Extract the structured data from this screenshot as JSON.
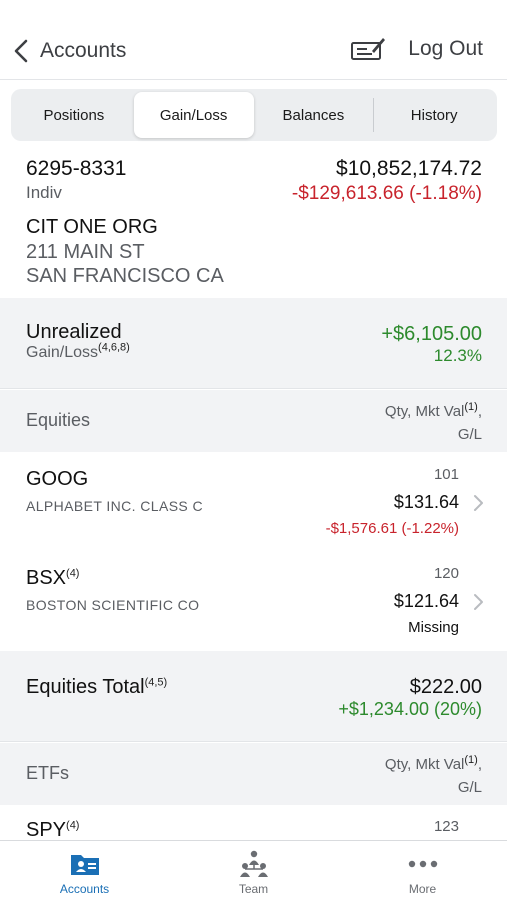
{
  "nav": {
    "back_label": "Accounts",
    "logout_label": "Log Out"
  },
  "tabs": [
    {
      "label": "Positions"
    },
    {
      "label": "Gain/Loss"
    },
    {
      "label": "Balances"
    },
    {
      "label": "History"
    }
  ],
  "active_tab": "Gain/Loss",
  "account": {
    "number": "6295-8331",
    "type": "Indiv",
    "value": "$10,852,174.72",
    "change": "-$129,613.66 (-1.18%)",
    "name": "CIT ONE ORG",
    "address_line1": "211 MAIN ST",
    "address_line2": "SAN FRANCISCO CA"
  },
  "unrealized": {
    "title": "Unrealized",
    "subtitle": "Gain/Loss",
    "subtitle_notes": "(4,6,8)",
    "value": "+$6,105.00",
    "percent": "12.3%"
  },
  "equities_header": {
    "label": "Equities",
    "col_line1": "Qty, Mkt Val",
    "col_note": "(1)",
    "col_sep": ",",
    "col_line2": "G/L"
  },
  "equities": [
    {
      "symbol": "GOOG",
      "notes": "",
      "description": "ALPHABET INC. CLASS C",
      "qty": "101",
      "price": "$131.64",
      "gain_loss": "-$1,576.61 (-1.22%)"
    },
    {
      "symbol": "BSX",
      "notes": "(4)",
      "description": "BOSTON SCIENTIFIC CO",
      "qty": "120",
      "price": "$121.64",
      "gain_loss": "Missing"
    }
  ],
  "equities_total": {
    "label": "Equities Total",
    "notes": "(4,5)",
    "value": "$222.00",
    "change": "+$1,234.00 (20%)"
  },
  "etfs_header": {
    "label": "ETFs",
    "col_line1": "Qty, Mkt Val",
    "col_note": "(1)",
    "col_sep": ",",
    "col_line2": "G/L"
  },
  "etfs": [
    {
      "symbol": "SPY",
      "notes": "(4)",
      "qty": "123"
    }
  ],
  "tabbar": [
    {
      "label": "Accounts",
      "icon": "folder-icon"
    },
    {
      "label": "Team",
      "icon": "team-icon"
    },
    {
      "label": "More",
      "icon": "more-dots-icon"
    }
  ],
  "colors": {
    "loss": "#c8232c",
    "gain": "#2d8a2d",
    "accent": "#1a6fb5"
  }
}
